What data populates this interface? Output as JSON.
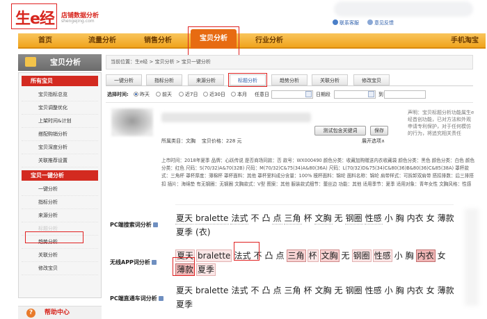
{
  "header": {
    "logo_text": "生e经",
    "logo_subtitle": "店铺数据分析",
    "logo_url": "shengejing.com",
    "contact_link": "联系客服",
    "feedback_link": "意见反馈"
  },
  "nav": {
    "items": [
      "首页",
      "流量分析",
      "销售分析",
      "宝贝分析",
      "行业分析"
    ],
    "active": "宝贝分析",
    "right_item": "手机淘宝"
  },
  "sidebar": {
    "title": "宝贝分析",
    "section1": "所有宝贝",
    "section1_items": [
      "宝贝指标总览",
      "宝贝调整优化",
      "上架时间&计划",
      "搭配购销分析",
      "宝贝深度分析",
      "关联推荐设置"
    ],
    "section2": "宝贝一键分析",
    "section2_items": [
      "一键分析",
      "指标分析",
      "来源分析",
      "标题分析",
      "趋势分析",
      "关联分析",
      "修改宝贝"
    ],
    "help": "帮助中心"
  },
  "breadcrumb": "当前位置：生e经 > 宝贝分析 > 宝贝一键分析",
  "subtabs": {
    "items": [
      "一键分析",
      "指标分析",
      "来源分析",
      "标题分析",
      "趋势分析",
      "关联分析",
      "修改宝贝"
    ],
    "active": "标题分析"
  },
  "filter": {
    "label": "选择时间:",
    "options": [
      "昨天",
      "前天",
      "近7日",
      "近30日",
      "本月"
    ],
    "selected": "昨天",
    "any_day": "任意日",
    "range_label": "日期段",
    "to_label": "到"
  },
  "product": {
    "test_button": "测试包含关键词",
    "save_button": "保存",
    "category": "所属类目：文胸",
    "price": "宝贝价格：228 元",
    "expand": "展开选项∧",
    "note": "声明：宝贝标题分析功能属生e经首创功能，已对方法和外观申请专利保护，对于任何模仿的行为，将追究相关责任"
  },
  "props": "上市时间：2018年夏季 品牌：心跃传说 是否商场同款：否 款号：WX000490 颜色分类：收藏加购赠送内衣收藏袋 颜色分类：黑色 颜色分类：白色 颜色分类：红色 尺码：S(70/32)A&70(32B) 尺码：M(70/32)C&75(34)A&80(36A) 尺码：L(70/32)D&75(34)C&80(36)B&80(36)C&85(38A) 罩杯款式：三角杯 罩杯厚度：薄棉杯 罩杯面料：其他 罩杯里料成分含量：100% 模杯面料：锦纶 面料名称：锦纶 肩带样式：可拆卸双肩带 搭扣排数：后三排搭扣 插片：海绵垫 有无钢圈：无钢圈 文胸款式：V型 图案：其他 服装款式细节：蕾丝边 功能：其他 适用季节：夏季 适用对象：青年女性 文胸风格：性感",
  "keywords": {
    "pc_search": {
      "label": "PC端搜索词分析",
      "words": [
        "夏天",
        "bralette",
        "法式",
        "不",
        "凸",
        "点",
        "三角",
        "杯",
        "文胸",
        "无",
        "钢圈",
        "性感",
        "小",
        "胸",
        "内衣",
        "女",
        "薄款",
        "夏季",
        "(衣)"
      ]
    },
    "app_wireless": {
      "label": "无线APP词分析",
      "words": [
        "夏天",
        "bralette",
        "法式",
        "不",
        "凸",
        "点",
        "三角",
        "杯",
        "文胸",
        "无",
        "钢圈",
        "性感",
        "小",
        "胸",
        "内衣",
        "女",
        "薄款",
        "夏季"
      ]
    },
    "pc_train": {
      "label": "PC端直通车词分析",
      "words": [
        "夏天",
        "bralette",
        "法式",
        "不",
        "凸",
        "点",
        "三角",
        "杯",
        "文胸",
        "无",
        "钢圈",
        "性感",
        "小",
        "胸",
        "内衣",
        "女",
        "薄款",
        "夏季"
      ]
    }
  },
  "colors": {
    "brand_red": "#d7261e",
    "nav_orange": "#f0a41d",
    "nav_active": "#e76b12",
    "highlight_outline": "#e02020"
  }
}
